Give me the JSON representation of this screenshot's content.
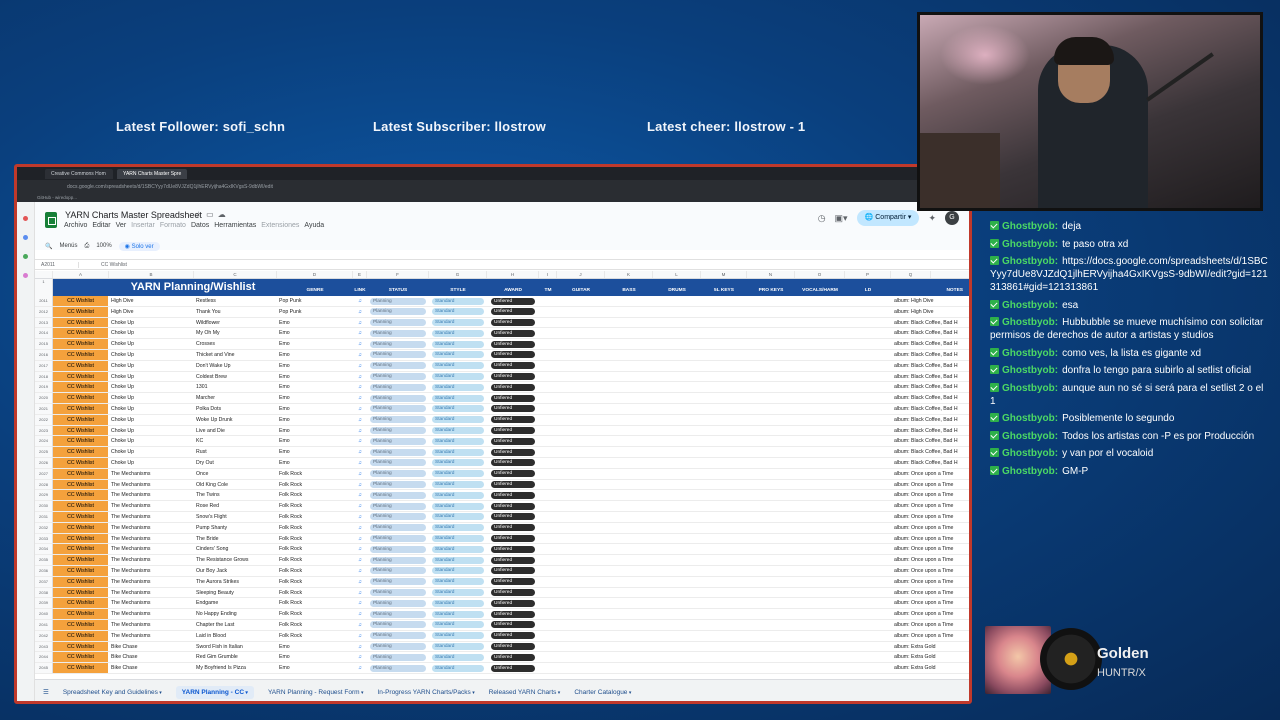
{
  "overlay": {
    "latest_follower": "Latest Follower: sofi_schn",
    "latest_subscriber": "Latest Subscriber: llostrow",
    "latest_cheer": "Latest cheer: llostrow - 1"
  },
  "browser": {
    "tabs": [
      "Creative Commons Hom",
      "YARN Charts Master Spre"
    ],
    "url": "docs.google.com/spreadsheets/d/1SBCYyy7dUe8VJZdQ1jlhERVyijha4GxIKVgsS-9dbWI/edit",
    "bookmark": "GitHub - wiredopp..."
  },
  "sheets": {
    "title": "YARN Charts Master Spreadsheet",
    "menu": [
      "Archivo",
      "Editar",
      "Ver",
      "Insertar",
      "Formato",
      "Datos",
      "Herramientas",
      "Extensiones",
      "Ayuda"
    ],
    "share": "Compartir",
    "avatar": "G",
    "toolbar": {
      "menus": "Menús",
      "zoom": "100%",
      "view_only": "Solo ver"
    },
    "namebox": "A2011",
    "formula": "CC Wishlist",
    "banner_title": "YARN Planning/Wishlist",
    "col_letters": [
      "A",
      "B",
      "C",
      "D",
      "E",
      "F",
      "G",
      "H",
      "I",
      "J",
      "K",
      "L",
      "M",
      "N",
      "O",
      "P",
      "Q"
    ],
    "headers": [
      "GENRE",
      "LINK",
      "STATUS",
      "STYLE",
      "AWARD",
      "TM",
      "GUITAR",
      "BASS",
      "DRUMS",
      "5L KEYS",
      "PRO KEYS",
      "VOCALS/HARM",
      "LD",
      "NOTES"
    ],
    "rows": [
      {
        "n": "2011",
        "wish": "CC Wishlist",
        "artist": "High Dive",
        "song": "Restless",
        "genre": "Pop Punk",
        "status": "Planning",
        "style": "Standard",
        "award": "Unfiered",
        "notes": "album: High Dive"
      },
      {
        "n": "2012",
        "wish": "CC Wishlist",
        "artist": "High Dive",
        "song": "Thank You",
        "genre": "Pop Punk",
        "status": "Planning",
        "style": "Standard",
        "award": "Unfiered",
        "notes": "album: High Dive"
      },
      {
        "n": "2013",
        "wish": "CC Wishlist",
        "artist": "Choke Up",
        "song": "Wildflower",
        "genre": "Emo",
        "status": "Planning",
        "style": "Standard",
        "award": "Unfiered",
        "notes": "album: Black Coffee, Bad H"
      },
      {
        "n": "2014",
        "wish": "CC Wishlist",
        "artist": "Choke Up",
        "song": "My Oh My",
        "genre": "Emo",
        "status": "Planning",
        "style": "Standard",
        "award": "Unfiered",
        "notes": "album: Black Coffee, Bad H"
      },
      {
        "n": "2015",
        "wish": "CC Wishlist",
        "artist": "Choke Up",
        "song": "Crosses",
        "genre": "Emo",
        "status": "Planning",
        "style": "Standard",
        "award": "Unfiered",
        "notes": "album: Black Coffee, Bad H"
      },
      {
        "n": "2016",
        "wish": "CC Wishlist",
        "artist": "Choke Up",
        "song": "Thicket and Vine",
        "genre": "Emo",
        "status": "Planning",
        "style": "Standard",
        "award": "Unfiered",
        "notes": "album: Black Coffee, Bad H"
      },
      {
        "n": "2017",
        "wish": "CC Wishlist",
        "artist": "Choke Up",
        "song": "Don't Wake Up",
        "genre": "Emo",
        "status": "Planning",
        "style": "Standard",
        "award": "Unfiered",
        "notes": "album: Black Coffee, Bad H"
      },
      {
        "n": "2018",
        "wish": "CC Wishlist",
        "artist": "Choke Up",
        "song": "Coldest Brew",
        "genre": "Emo",
        "status": "Planning",
        "style": "Standard",
        "award": "Unfiered",
        "notes": "album: Black Coffee, Bad H"
      },
      {
        "n": "2019",
        "wish": "CC Wishlist",
        "artist": "Choke Up",
        "song": "1301",
        "genre": "Emo",
        "status": "Planning",
        "style": "Standard",
        "award": "Unfiered",
        "notes": "album: Black Coffee, Bad H"
      },
      {
        "n": "2020",
        "wish": "CC Wishlist",
        "artist": "Choke Up",
        "song": "Marcher",
        "genre": "Emo",
        "status": "Planning",
        "style": "Standard",
        "award": "Unfiered",
        "notes": "album: Black Coffee, Bad H"
      },
      {
        "n": "2021",
        "wish": "CC Wishlist",
        "artist": "Choke Up",
        "song": "Polka Dots",
        "genre": "Emo",
        "status": "Planning",
        "style": "Standard",
        "award": "Unfiered",
        "notes": "album: Black Coffee, Bad H"
      },
      {
        "n": "2022",
        "wish": "CC Wishlist",
        "artist": "Choke Up",
        "song": "Woke Up Drunk",
        "genre": "Emo",
        "status": "Planning",
        "style": "Standard",
        "award": "Unfiered",
        "notes": "album: Black Coffee, Bad H"
      },
      {
        "n": "2023",
        "wish": "CC Wishlist",
        "artist": "Choke Up",
        "song": "Live and Die",
        "genre": "Emo",
        "status": "Planning",
        "style": "Standard",
        "award": "Unfiered",
        "notes": "album: Black Coffee, Bad H"
      },
      {
        "n": "2024",
        "wish": "CC Wishlist",
        "artist": "Choke Up",
        "song": "KC",
        "genre": "Emo",
        "status": "Planning",
        "style": "Standard",
        "award": "Unfiered",
        "notes": "album: Black Coffee, Bad H"
      },
      {
        "n": "2025",
        "wish": "CC Wishlist",
        "artist": "Choke Up",
        "song": "Rust",
        "genre": "Emo",
        "status": "Planning",
        "style": "Standard",
        "award": "Unfiered",
        "notes": "album: Black Coffee, Bad H"
      },
      {
        "n": "2026",
        "wish": "CC Wishlist",
        "artist": "Choke Up",
        "song": "Dry Out",
        "genre": "Emo",
        "status": "Planning",
        "style": "Standard",
        "award": "Unfiered",
        "notes": "album: Black Coffee, Bad H"
      },
      {
        "n": "2027",
        "wish": "CC Wishlist",
        "artist": "The Mechanisms",
        "song": "Once",
        "genre": "Folk Rock",
        "status": "Planning",
        "style": "Standard",
        "award": "Unfiered",
        "notes": "album: Once upon a Time"
      },
      {
        "n": "2028",
        "wish": "CC Wishlist",
        "artist": "The Mechanisms",
        "song": "Old King Cole",
        "genre": "Folk Rock",
        "status": "Planning",
        "style": "Standard",
        "award": "Unfiered",
        "notes": "album: Once upon a Time"
      },
      {
        "n": "2029",
        "wish": "CC Wishlist",
        "artist": "The Mechanisms",
        "song": "The Twins",
        "genre": "Folk Rock",
        "status": "Planning",
        "style": "Standard",
        "award": "Unfiered",
        "notes": "album: Once upon a Time"
      },
      {
        "n": "2030",
        "wish": "CC Wishlist",
        "artist": "The Mechanisms",
        "song": "Rose Red",
        "genre": "Folk Rock",
        "status": "Planning",
        "style": "Standard",
        "award": "Unfiered",
        "notes": "album: Once upon a Time"
      },
      {
        "n": "2031",
        "wish": "CC Wishlist",
        "artist": "The Mechanisms",
        "song": "Snow's Flight",
        "genre": "Folk Rock",
        "status": "Planning",
        "style": "Standard",
        "award": "Unfiered",
        "notes": "album: Once upon a Time"
      },
      {
        "n": "2032",
        "wish": "CC Wishlist",
        "artist": "The Mechanisms",
        "song": "Pump Shanty",
        "genre": "Folk Rock",
        "status": "Planning",
        "style": "Standard",
        "award": "Unfiered",
        "notes": "album: Once upon a Time"
      },
      {
        "n": "2033",
        "wish": "CC Wishlist",
        "artist": "The Mechanisms",
        "song": "The Bride",
        "genre": "Folk Rock",
        "status": "Planning",
        "style": "Standard",
        "award": "Unfiered",
        "notes": "album: Once upon a Time"
      },
      {
        "n": "2034",
        "wish": "CC Wishlist",
        "artist": "The Mechanisms",
        "song": "Cinders' Song",
        "genre": "Folk Rock",
        "status": "Planning",
        "style": "Standard",
        "award": "Unfiered",
        "notes": "album: Once upon a Time"
      },
      {
        "n": "2035",
        "wish": "CC Wishlist",
        "artist": "The Mechanisms",
        "song": "The Resistance Grows",
        "genre": "Folk Rock",
        "status": "Planning",
        "style": "Standard",
        "award": "Unfiered",
        "notes": "album: Once upon a Time"
      },
      {
        "n": "2036",
        "wish": "CC Wishlist",
        "artist": "The Mechanisms",
        "song": "Our Boy Jack",
        "genre": "Folk Rock",
        "status": "Planning",
        "style": "Standard",
        "award": "Unfiered",
        "notes": "album: Once upon a Time"
      },
      {
        "n": "2037",
        "wish": "CC Wishlist",
        "artist": "The Mechanisms",
        "song": "The Aurora Strikes",
        "genre": "Folk Rock",
        "status": "Planning",
        "style": "Standard",
        "award": "Unfiered",
        "notes": "album: Once upon a Time"
      },
      {
        "n": "2038",
        "wish": "CC Wishlist",
        "artist": "The Mechanisms",
        "song": "Sleeping Beauty",
        "genre": "Folk Rock",
        "status": "Planning",
        "style": "Standard",
        "award": "Unfiered",
        "notes": "album: Once upon a Time"
      },
      {
        "n": "2039",
        "wish": "CC Wishlist",
        "artist": "The Mechanisms",
        "song": "Endgame",
        "genre": "Folk Rock",
        "status": "Planning",
        "style": "Standard",
        "award": "Unfiered",
        "notes": "album: Once upon a Time"
      },
      {
        "n": "2040",
        "wish": "CC Wishlist",
        "artist": "The Mechanisms",
        "song": "No Happy Ending",
        "genre": "Folk Rock",
        "status": "Planning",
        "style": "Standard",
        "award": "Unfiered",
        "notes": "album: Once upon a Time"
      },
      {
        "n": "2041",
        "wish": "CC Wishlist",
        "artist": "The Mechanisms",
        "song": "Chapter the Last",
        "genre": "Folk Rock",
        "status": "Planning",
        "style": "Standard",
        "award": "Unfiered",
        "notes": "album: Once upon a Time"
      },
      {
        "n": "2042",
        "wish": "CC Wishlist",
        "artist": "The Mechanisms",
        "song": "Laid in Blood",
        "genre": "Folk Rock",
        "status": "Planning",
        "style": "Standard",
        "award": "Unfiered",
        "notes": "album: Once upon a Time"
      },
      {
        "n": "2043",
        "wish": "CC Wishlist",
        "artist": "Bike Chase",
        "song": "Sword Fish in Italian",
        "genre": "Emo",
        "status": "Planning",
        "style": "Standard",
        "award": "Unfiered",
        "notes": "album: Extra Gold"
      },
      {
        "n": "2044",
        "wish": "CC Wishlist",
        "artist": "Bike Chase",
        "song": "Red Gim Grumble",
        "genre": "Emo",
        "status": "Planning",
        "style": "Standard",
        "award": "Unfiered",
        "notes": "album: Extra Gold"
      },
      {
        "n": "2045",
        "wish": "CC Wishlist",
        "artist": "Bike Chase",
        "song": "My Boyfriend Is Pizza",
        "genre": "Emo",
        "status": "Planning",
        "style": "Standard",
        "award": "Unfiered",
        "notes": "album: Extra Gold"
      }
    ],
    "sheet_tabs": [
      "Spreadsheet Key and Guidelines",
      "YARN Planning - CC",
      "YARN Planning - Request Form",
      "In-Progress YARN Charts/Packs",
      "Released YARN Charts",
      "Charter Catalogue"
    ],
    "active_tab": "YARN Planning - CC"
  },
  "chat": [
    {
      "user": "Ghostbyob:",
      "text": "deja"
    },
    {
      "user": "Ghostbyob:",
      "text": "te paso otra xd"
    },
    {
      "user": "Ghostbyob:",
      "text": "https://docs.google.com/spreadsheets/d/1SBCYyy7dUe8VJZdQ1jlhERVyijha4GxIKVgsS-9dbWI/edit?gid=121313861#gid=121313861"
    },
    {
      "user": "Ghostbyob:",
      "text": "esa"
    },
    {
      "user": "Ghostbyob:",
      "text": "Hubbubble se mueve muchísimo con solicitar permisos de derechos de autor a artistas y studios"
    },
    {
      "user": "Ghostbyob:",
      "text": "como ves, la lista es gigante xd"
    },
    {
      "user": "Ghostbyob:",
      "text": "donfra lo tengo para subirlo al setlist oficial"
    },
    {
      "user": "Ghostbyob:",
      "text": "aunque aun no sé si será para el setlist 2 o el 1"
    },
    {
      "user": "Ghostbyob:",
      "text": "Posiblemente lo segundo"
    },
    {
      "user": "Ghostbyob:",
      "text": "Todos los artistas con -P es por Producción"
    },
    {
      "user": "Ghostbyob:",
      "text": "y van por el vocaloid"
    },
    {
      "user": "Ghostbyob:",
      "text": "GM-P"
    }
  ],
  "now_playing": {
    "title": "Golden",
    "artist": "HUNTR/X"
  },
  "colors": {
    "banner": "#1c4f9c",
    "wishlist": "#f4a13c",
    "status_pill": "#c6dbef",
    "chat_user": "#4cd964"
  }
}
